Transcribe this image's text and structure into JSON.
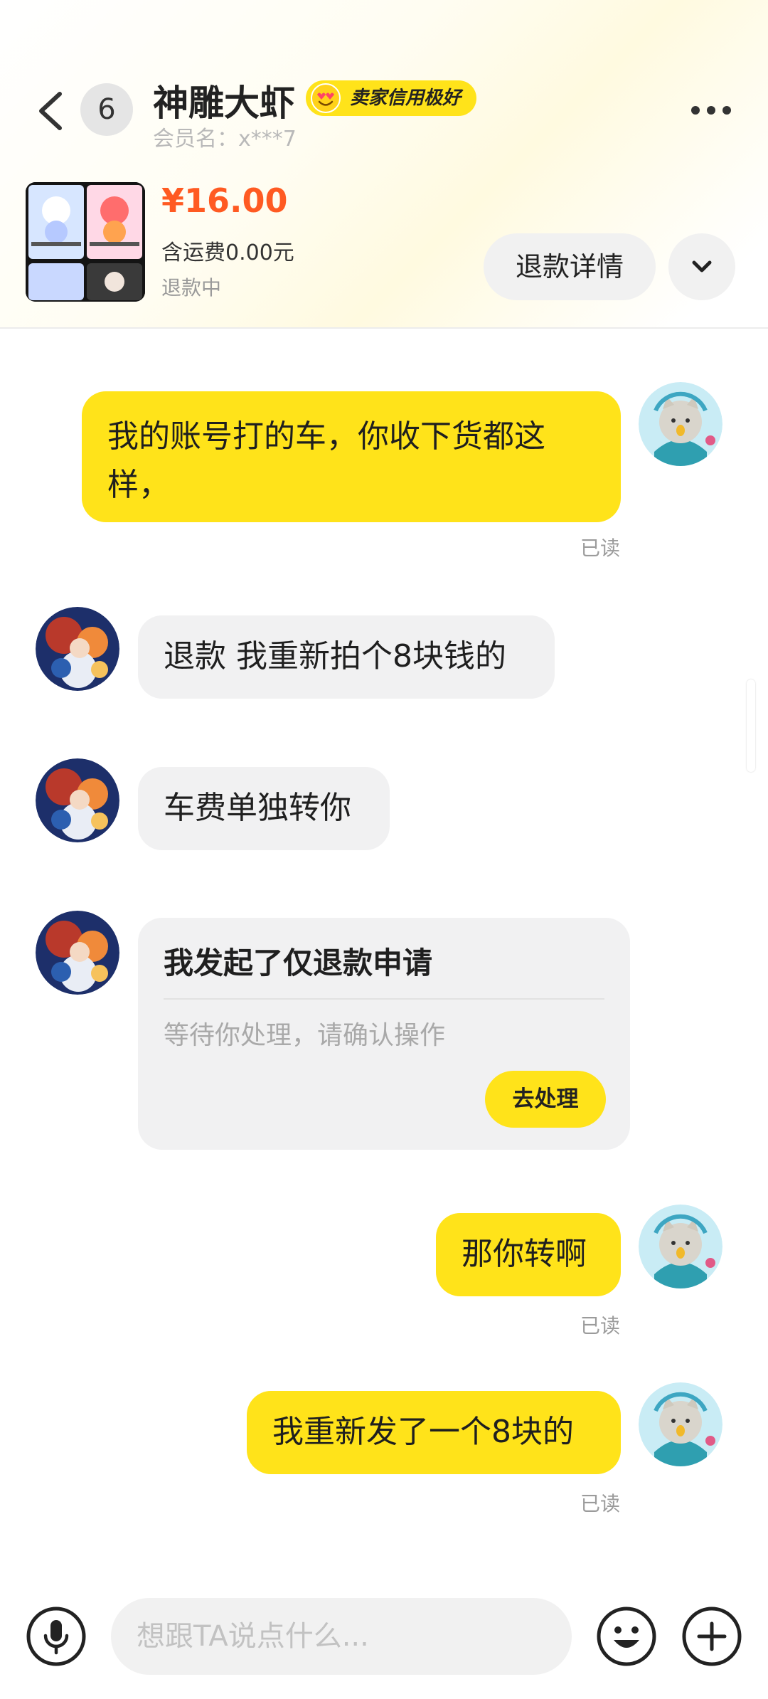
{
  "header": {
    "unread_count": "6",
    "shop_name": "神雕大虾",
    "credit_badge": "卖家信用极好",
    "member_label": "会员名：x***7"
  },
  "product": {
    "price": "¥16.00",
    "shipping": "含运费0.00元",
    "status": "退款中",
    "refund_button": "退款详情"
  },
  "messages": [
    {
      "sender": "me",
      "text": "我的账号打的车，你收下货都这样，",
      "line1": "我的账号打的车，你收下货都这",
      "line2": "样，",
      "read": "已读"
    },
    {
      "sender": "other",
      "text": "退款 我重新拍个8块钱的"
    },
    {
      "sender": "other",
      "text": "车费单独转你"
    },
    {
      "sender": "other",
      "type": "refund_card",
      "title": "我发起了仅退款申请",
      "subtitle": "等待你处理，请确认操作",
      "button": "去处理"
    },
    {
      "sender": "me",
      "text": "那你转啊",
      "read": "已读"
    },
    {
      "sender": "me",
      "text": "我重新发了一个8块的",
      "read": "已读"
    }
  ],
  "input": {
    "placeholder": "想跟TA说点什么..."
  },
  "icons": {
    "back": "back-arrow-icon",
    "more": "more-dots-icon",
    "expand": "chevron-down-icon",
    "voice": "microphone-icon",
    "emoji": "emoji-icon",
    "plus": "plus-icon"
  },
  "colors": {
    "accent_yellow": "#ffe31a",
    "price_orange": "#ff5a22",
    "bubble_grey": "#f1f1f2"
  }
}
